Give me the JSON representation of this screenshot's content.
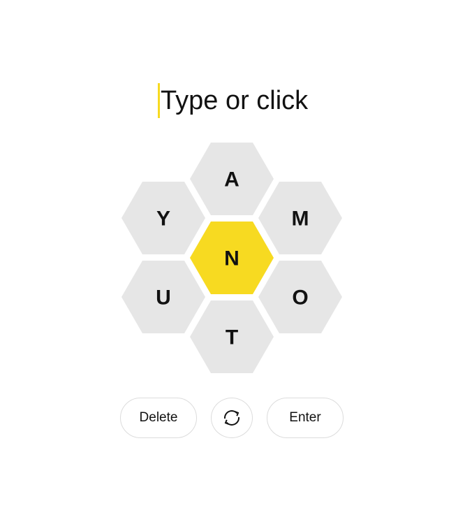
{
  "input": {
    "placeholder": "Type or click"
  },
  "hive": {
    "center_letter": "N",
    "outer_letters": [
      "A",
      "M",
      "O",
      "T",
      "U",
      "Y"
    ]
  },
  "controls": {
    "delete_label": "Delete",
    "shuffle_icon": "shuffle-icon",
    "enter_label": "Enter"
  },
  "colors": {
    "center_cell": "#f7da21",
    "outer_cell": "#e6e6e6",
    "cursor": "#f7da21",
    "text": "#121212",
    "button_border": "#dcdcdc"
  }
}
